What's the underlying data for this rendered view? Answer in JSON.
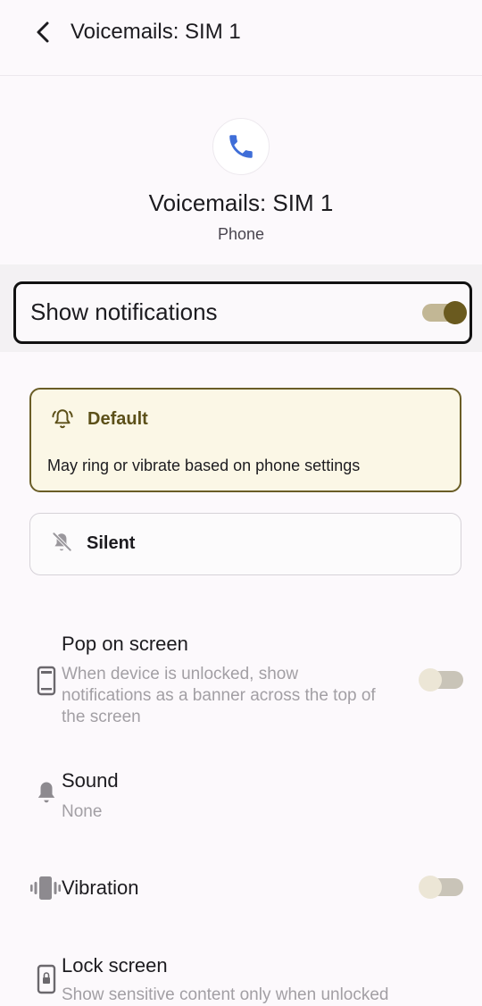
{
  "header": {
    "title": "Voicemails: SIM 1"
  },
  "app": {
    "name": "Voicemails: SIM 1",
    "source": "Phone"
  },
  "show_notifications": {
    "label": "Show notifications",
    "enabled": true
  },
  "alert_modes": [
    {
      "title": "Default",
      "description": "May ring or vibrate based on phone settings",
      "selected": true
    },
    {
      "title": "Silent",
      "selected": false
    }
  ],
  "settings": {
    "pop_on_screen": {
      "title": "Pop on screen",
      "description": "When device is unlocked, show notifications as a banner across the top of the screen",
      "enabled": false
    },
    "sound": {
      "title": "Sound",
      "value": "None"
    },
    "vibration": {
      "title": "Vibration",
      "enabled": false
    },
    "lock_screen": {
      "title": "Lock screen",
      "description": "Show sensitive content only when unlocked"
    }
  },
  "colors": {
    "accent": "#6a5a1f",
    "app_icon": "#3f6ed8",
    "selected_card_bg": "#fbf7e6"
  }
}
